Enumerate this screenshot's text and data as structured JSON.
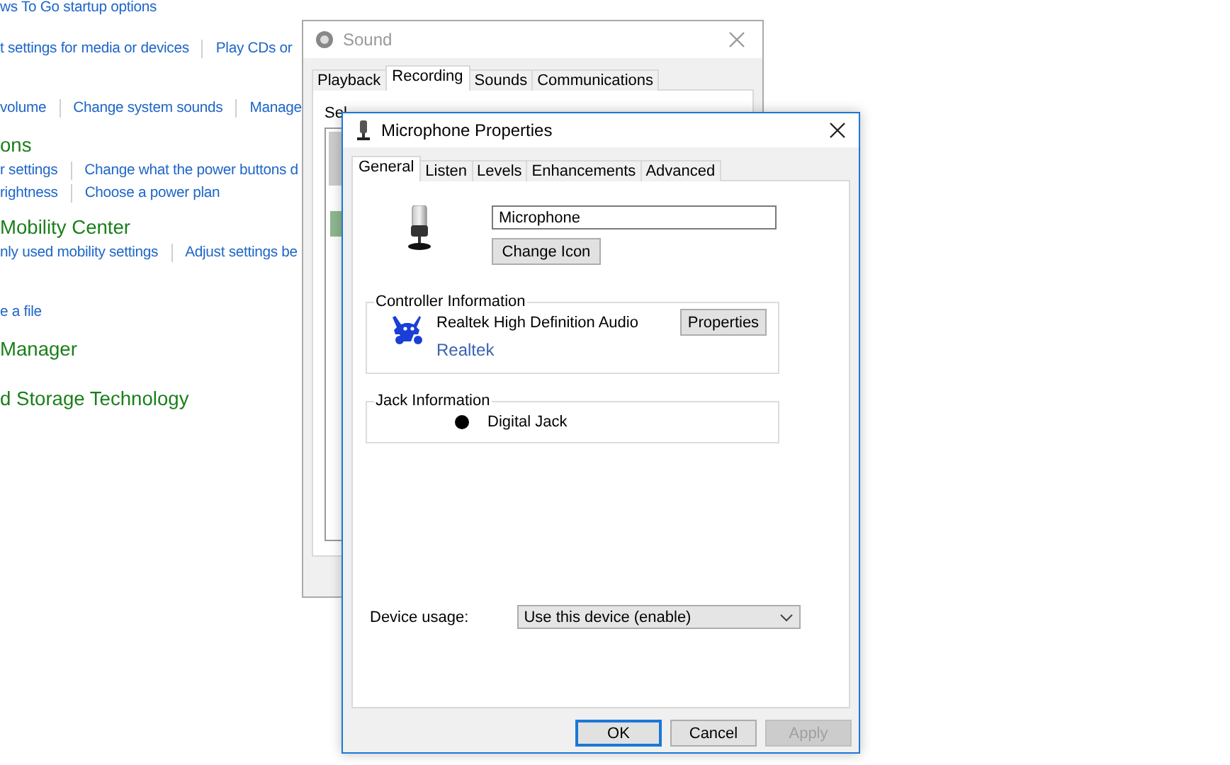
{
  "control_panel": {
    "groups": [
      {
        "kind": "links",
        "rows": [
          [
            "ws To Go startup options"
          ]
        ]
      },
      {
        "kind": "links",
        "rows": [
          [
            "t settings for media or devices",
            "Play CDs or"
          ]
        ]
      },
      {
        "kind": "links",
        "rows": [
          [
            "volume",
            "Change system sounds",
            "Manage"
          ]
        ]
      },
      {
        "kind": "section",
        "heading": "ons",
        "rows": [
          [
            "r settings",
            "Change what the power buttons d"
          ],
          [
            "rightness",
            "Choose a power plan"
          ]
        ]
      },
      {
        "kind": "section",
        "heading": "Mobility Center",
        "rows": [
          [
            "nly used mobility settings",
            "Adjust settings be"
          ]
        ]
      },
      {
        "kind": "links",
        "rows": [
          [
            "e a file"
          ]
        ]
      },
      {
        "kind": "section",
        "heading": "Manager"
      },
      {
        "kind": "section",
        "heading": "d Storage Technology"
      }
    ]
  },
  "sound_window": {
    "title": "Sound",
    "tabs": [
      {
        "label": "Playback",
        "selected": false
      },
      {
        "label": "Recording",
        "selected": true
      },
      {
        "label": "Sounds",
        "selected": false
      },
      {
        "label": "Communications",
        "selected": false
      }
    ],
    "partial_text": "Sel"
  },
  "properties_window": {
    "title": "Microphone Properties",
    "tabs": [
      {
        "label": "General",
        "selected": true
      },
      {
        "label": "Listen",
        "selected": false
      },
      {
        "label": "Levels",
        "selected": false
      },
      {
        "label": "Enhancements",
        "selected": false
      },
      {
        "label": "Advanced",
        "selected": false
      }
    ],
    "device_name": {
      "value": "Microphone"
    },
    "change_icon_button": "Change Icon",
    "controller_information": {
      "title": "Controller Information",
      "device": "Realtek High Definition Audio",
      "link": "Realtek",
      "button": "Properties"
    },
    "jack_information": {
      "title": "Jack Information",
      "jacks": [
        {
          "name": "Digital Jack",
          "color": "#000000"
        }
      ]
    },
    "device_usage": {
      "label": "Device usage:",
      "value": "Use this device (enable)"
    },
    "buttons": [
      {
        "label": "OK",
        "focused": true,
        "disabled": false
      },
      {
        "label": "Cancel",
        "focused": false,
        "disabled": false
      },
      {
        "label": "Apply",
        "focused": false,
        "disabled": true
      }
    ]
  }
}
